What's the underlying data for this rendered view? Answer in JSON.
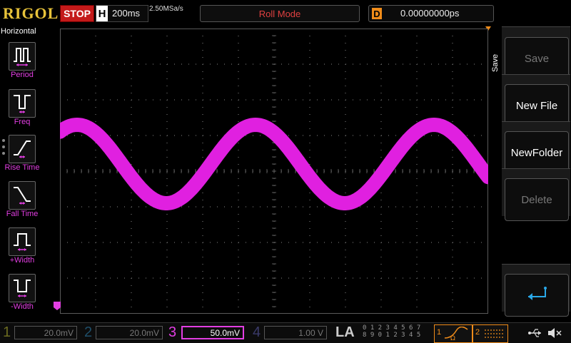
{
  "topbar": {
    "logo": "RIGOL",
    "run_status": "STOP",
    "horizontal_label": "H",
    "timebase": "200ms",
    "sample_rate": "2.50MSa/s",
    "mode": "Roll Mode",
    "delay_label": "D",
    "delay_value": "0.00000000ps"
  },
  "left_menu": {
    "title": "Horizontal",
    "items": [
      {
        "label": "Period",
        "icon": "period-icon"
      },
      {
        "label": "Freq",
        "icon": "freq-icon"
      },
      {
        "label": "Rise Time",
        "icon": "rise-time-icon"
      },
      {
        "label": "Fall Time",
        "icon": "fall-time-icon"
      },
      {
        "label": "+Width",
        "icon": "positive-width-icon"
      },
      {
        "label": "-Width",
        "icon": "negative-width-icon"
      }
    ]
  },
  "right_menu": {
    "tab": "Save",
    "buttons": [
      {
        "label": "Save",
        "enabled": false
      },
      {
        "label": "New File",
        "enabled": true
      },
      {
        "label": "NewFolder",
        "enabled": true
      },
      {
        "label": "Delete",
        "enabled": false
      }
    ],
    "return_icon": "return-arrow-icon"
  },
  "channels": [
    {
      "num": "1",
      "scale": "20.0mV",
      "color": "#6a6a20",
      "active": false
    },
    {
      "num": "2",
      "scale": "20.0mV",
      "color": "#1f4f6a",
      "active": false
    },
    {
      "num": "3",
      "scale": "50.0mV",
      "color": "#e23ee2",
      "active": true
    },
    {
      "num": "4",
      "scale": "1.00 V",
      "color": "#3a3a6a",
      "active": false
    }
  ],
  "logic": {
    "label": "LA",
    "row1": "0 1 2 3  4 5 6 7",
    "row2": "8 9 0 1  2 3 4 5"
  },
  "trigger": {
    "source": "1",
    "source2": "2"
  },
  "status_icons": [
    "usb-icon",
    "mute-icon"
  ],
  "colors": {
    "waveform": "#e020e0",
    "grid": "#5a5a5a",
    "accent": "#f08c1a",
    "stop": "#c41a1a"
  }
}
